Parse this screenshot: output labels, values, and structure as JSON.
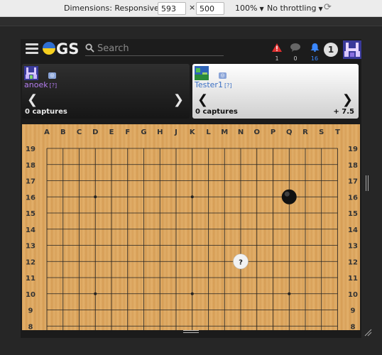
{
  "devtools": {
    "dimensions_label": "Dimensions: Responsive",
    "width": "593",
    "height": "500",
    "times": "×",
    "zoom": "100%",
    "throttling": "No throttling"
  },
  "nav": {
    "logo_text": "GS",
    "search_placeholder": "Search",
    "warning_count": "1",
    "chat_count": "0",
    "notification_count": "16",
    "badge": "1"
  },
  "players": {
    "black": {
      "name": "anoek",
      "rank": "[?]",
      "captures": "0 captures"
    },
    "white": {
      "name": "Tester1",
      "rank": "[?]",
      "captures": "0 captures",
      "komi": "+ 7.5"
    }
  },
  "board": {
    "size": 19,
    "columns": [
      "A",
      "B",
      "C",
      "D",
      "E",
      "F",
      "G",
      "H",
      "J",
      "K",
      "L",
      "M",
      "N",
      "O",
      "P",
      "Q",
      "R",
      "S",
      "T"
    ],
    "visible_rows": [
      "19",
      "18",
      "17",
      "16",
      "15",
      "14",
      "13",
      "12",
      "11",
      "10",
      "9",
      "8"
    ],
    "stones": [
      {
        "color": "black",
        "col": "Q",
        "row": 16,
        "mark": ""
      },
      {
        "color": "white",
        "col": "N",
        "row": 12,
        "mark": "?"
      }
    ],
    "star_points": [
      "D16",
      "K16",
      "Q16",
      "D10",
      "K10",
      "Q10"
    ]
  },
  "colors": {
    "accent_blue": "#3a87ff",
    "warning_red": "#e03030",
    "black_name": "#b47df0",
    "white_name": "#3a6fc4"
  }
}
